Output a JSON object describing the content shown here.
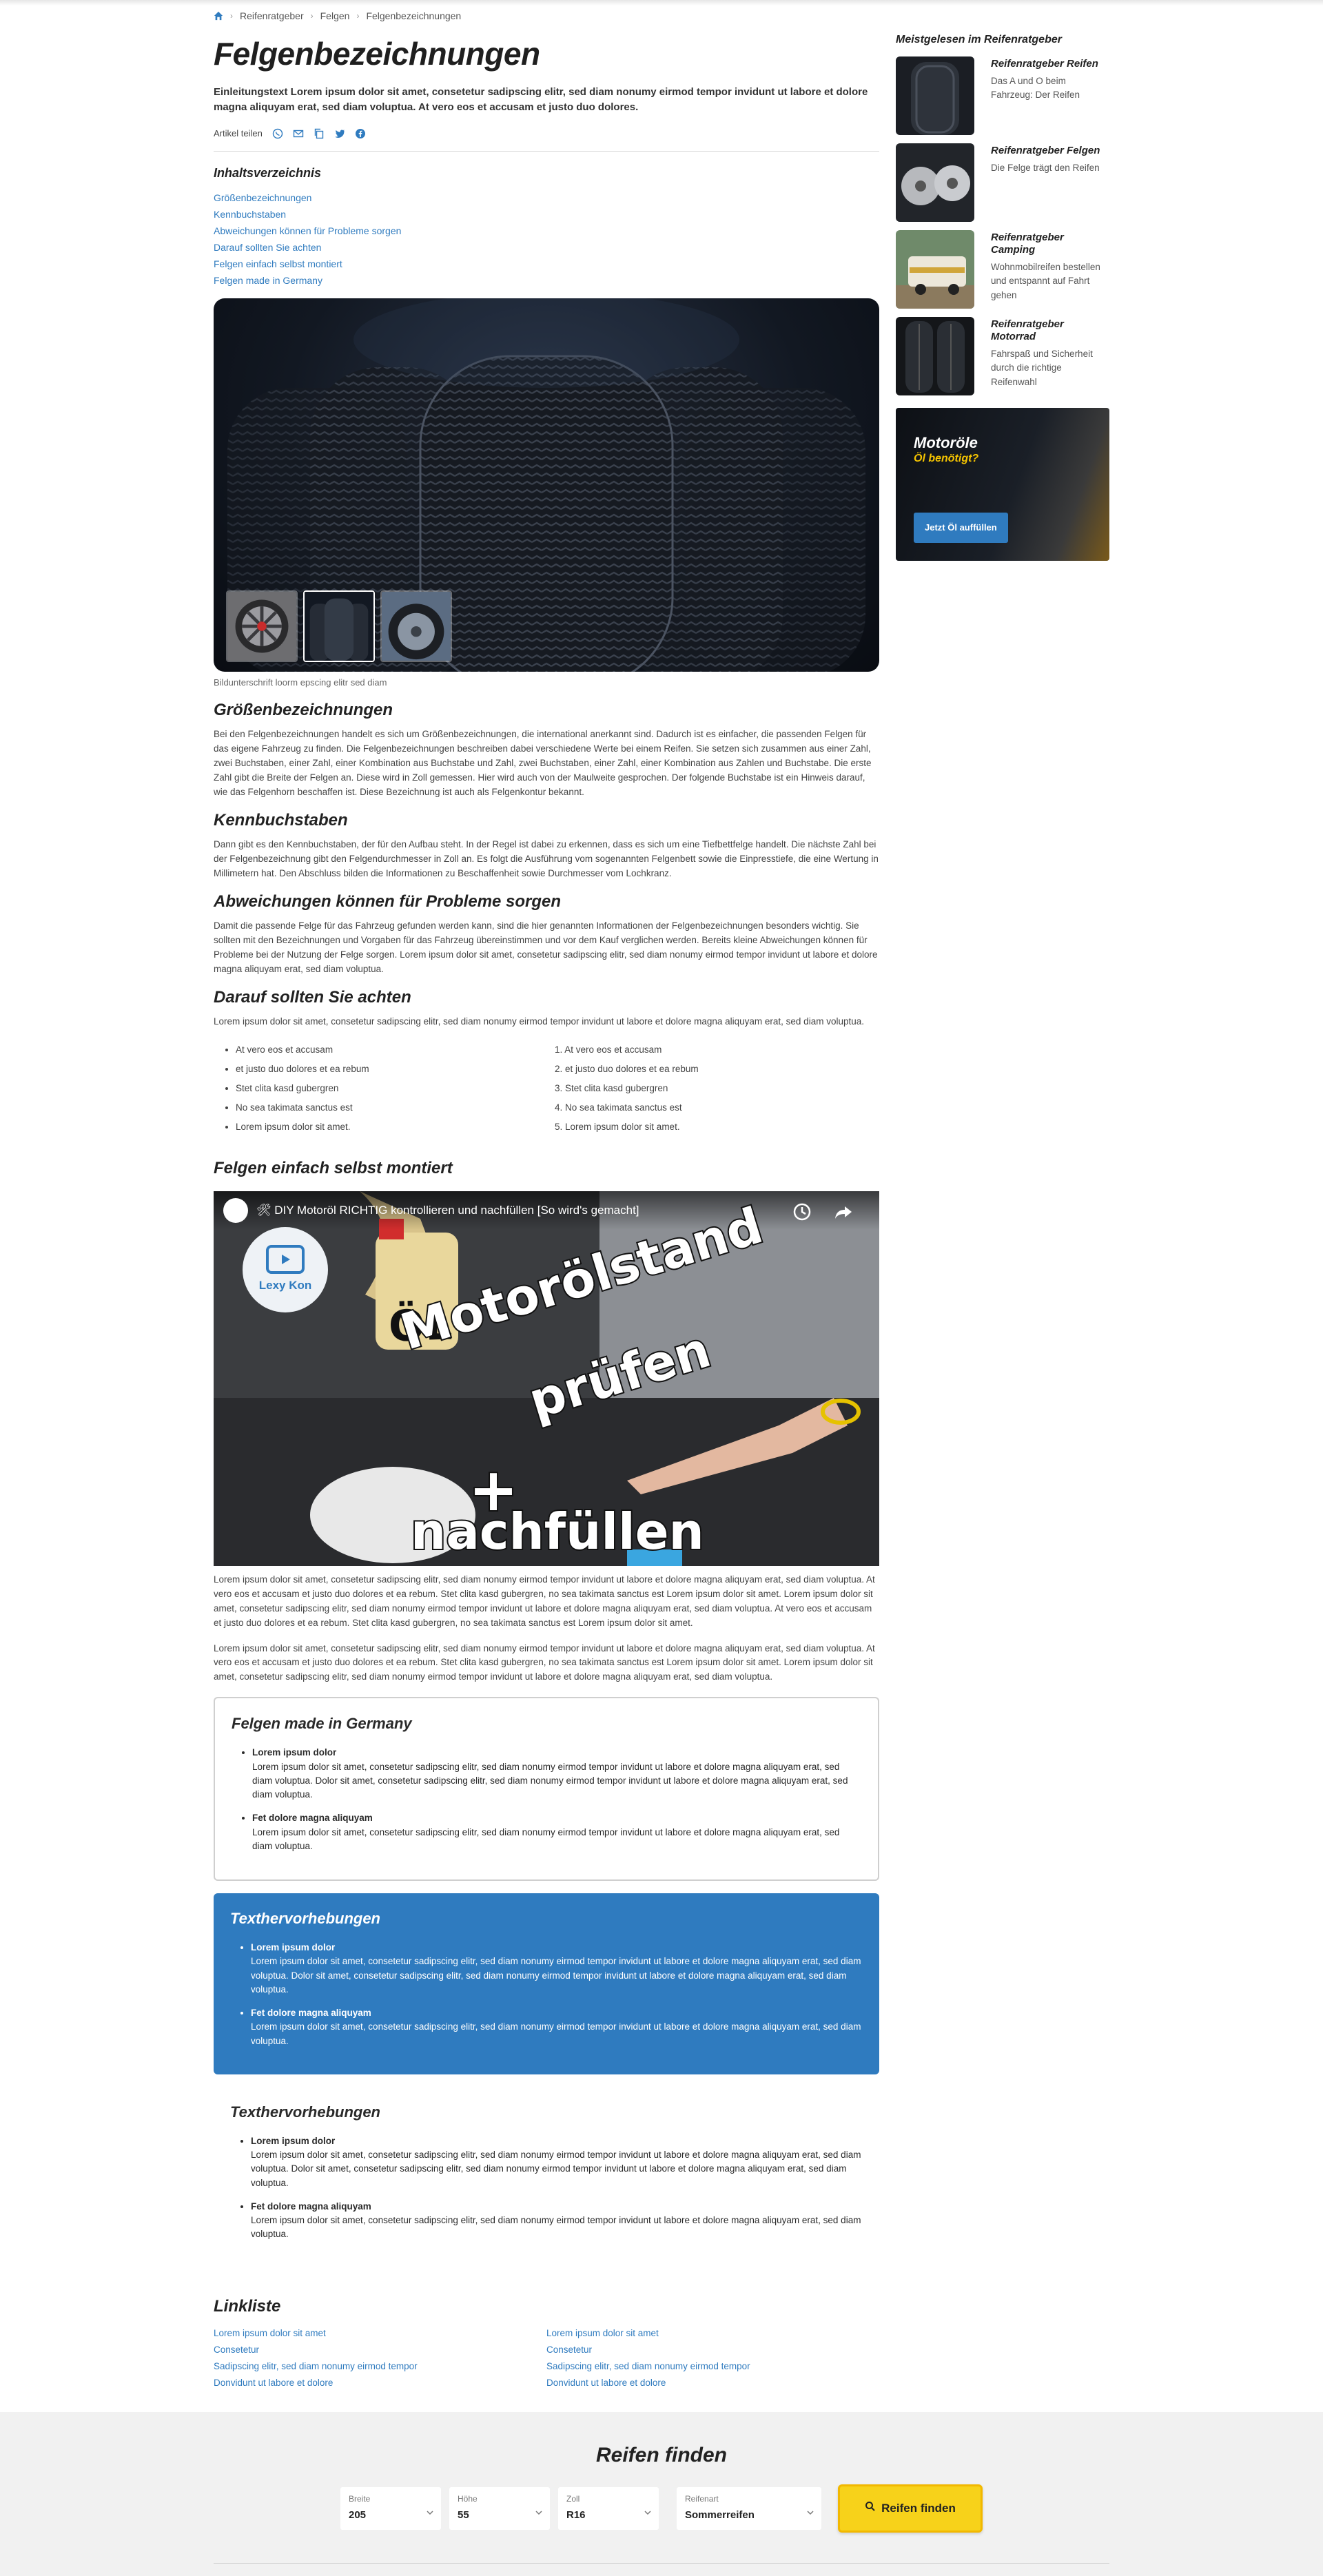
{
  "breadcrumb": [
    "Reifenratgeber",
    "Felgen",
    "Felgenbezeichnungen"
  ],
  "page_title": "Felgenbezeichnungen",
  "intro": "Einleitungstext Lorem ipsum dolor sit amet, consetetur sadipscing elitr, sed diam nonumy eirmod tempor invidunt ut labore et dolore magna aliquyam erat, sed diam voluptua. At vero eos et accusam et justo duo dolores.",
  "share_label": "Artikel teilen",
  "share_icons": [
    "whatsapp-icon",
    "mail-icon",
    "copy-icon",
    "twitter-icon",
    "facebook-icon"
  ],
  "toc": {
    "title": "Inhaltsverzeichnis",
    "items": [
      "Größenbezeichnungen",
      "Kennbuchstaben",
      "Abweichungen können für Probleme sorgen",
      "Darauf sollten Sie achten",
      "Felgen einfach selbst montiert",
      "Felgen made in Germany"
    ]
  },
  "hero_caption": "Bildunterschrift loorm epscing elitr sed diam",
  "sections": [
    {
      "title": "Größenbezeichnungen",
      "text": "Bei den Felgenbezeichnungen handelt es sich um Größenbezeichnungen, die international anerkannt sind. Dadurch ist es einfacher, die passenden Felgen für das eigene Fahrzeug zu finden. Die Felgenbezeichnungen beschreiben dabei verschiedene Werte bei einem Reifen. Sie setzen sich zusammen aus einer Zahl, zwei Buchstaben, einer Zahl, einer Kombination aus Buchstabe und Zahl, zwei Buchstaben, einer Zahl, einer Kombination aus Zahlen und Buchstabe. Die erste Zahl gibt die Breite der Felgen an. Diese wird in Zoll gemessen. Hier wird auch von der Maulweite gesprochen. Der folgende Buchstabe ist ein Hinweis darauf, wie das Felgenhorn beschaffen ist. Diese Bezeichnung ist auch als Felgenkontur bekannt."
    },
    {
      "title": "Kennbuchstaben",
      "text": "Dann gibt es den Kennbuchstaben, der für den Aufbau steht. In der Regel ist dabei zu erkennen, dass es sich um eine Tiefbettfelge handelt. Die nächste Zahl bei der Felgenbezeichnung gibt den Felgendurchmesser in Zoll an. Es folgt die Ausführung vom sogenannten Felgenbett sowie die Einpresstiefe, die eine Wertung in Millimetern hat. Den Abschluss bilden die Informationen zu Beschaffenheit sowie Durchmesser vom Lochkranz."
    },
    {
      "title": "Abweichungen können für Probleme sorgen",
      "text": "Damit die passende Felge für das Fahrzeug gefunden werden kann, sind die hier genannten Informationen der Felgenbezeichnungen besonders wichtig. Sie sollten mit den Bezeichnungen und Vorgaben für das Fahrzeug übereinstimmen und vor dem Kauf verglichen werden. Bereits kleine Abweichungen können für Probleme bei der Nutzung der Felge sorgen. Lorem ipsum dolor sit amet, consetetur sadipscing elitr, sed diam nonumy eirmod tempor invidunt ut labore et dolore magna aliquyam erat, sed diam voluptua."
    },
    {
      "title": "Darauf sollten Sie achten",
      "text": "Lorem ipsum dolor sit amet, consetetur sadipscing elitr, sed diam nonumy eirmod tempor invidunt ut labore et dolore magna aliquyam erat, sed diam voluptua."
    }
  ],
  "bullet_list": [
    "At vero eos et accusam",
    "et justo duo dolores et ea rebum",
    "Stet clita kasd gubergren",
    "No sea takimata sanctus est",
    "Lorem ipsum dolor sit amet."
  ],
  "numbered_list": [
    "1. At vero eos et accusam",
    "2. et justo duo dolores et ea rebum",
    "3. Stet clita kasd gubergren",
    "4. No sea takimata sanctus est",
    "5. Lorem ipsum dolor sit amet."
  ],
  "video_section": {
    "title": "Felgen einfach selbst montiert",
    "video_title": "🛠 DIY Motoröl RICHTIG kontrollieren und nachfüllen [So wird's gemacht]",
    "channel": "Lexy Kon",
    "overlay_1": "ÖL",
    "overlay_2": "Motorölstand",
    "overlay_3": "prüfen",
    "overlay_4": "+",
    "overlay_5": "nachfüllen"
  },
  "after_video": [
    "Lorem ipsum dolor sit amet, consetetur sadipscing elitr, sed diam nonumy eirmod tempor invidunt ut labore et dolore magna aliquyam erat, sed diam voluptua. At vero eos et accusam et justo duo dolores et ea rebum. Stet clita kasd gubergren, no sea takimata sanctus est Lorem ipsum dolor sit amet. Lorem ipsum dolor sit amet, consetetur sadipscing elitr, sed diam nonumy eirmod tempor invidunt ut labore et dolore magna aliquyam erat, sed diam voluptua. At vero eos et accusam et justo duo dolores et ea rebum. Stet clita kasd gubergren, no sea takimata sanctus est Lorem ipsum dolor sit amet.",
    "Lorem ipsum dolor sit amet, consetetur sadipscing elitr, sed diam nonumy eirmod tempor invidunt ut labore et dolore magna aliquyam erat, sed diam voluptua. At vero eos et accusam et justo duo dolores et ea rebum. Stet clita kasd gubergren, no sea takimata sanctus est Lorem ipsum dolor sit amet. Lorem ipsum dolor sit amet, consetetur sadipscing elitr, sed diam nonumy eirmod tempor invidunt ut labore et dolore magna aliquyam erat, sed diam voluptua."
  ],
  "box_outline": {
    "title": "Felgen made in Germany",
    "items": [
      {
        "head": "Lorem ipsum dolor",
        "text": "Lorem ipsum dolor sit amet, consetetur sadipscing elitr, sed diam nonumy eirmod tempor invidunt ut labore et dolore magna aliquyam erat, sed diam voluptua. Dolor sit amet, consetetur sadipscing elitr, sed diam nonumy eirmod tempor invidunt ut labore et dolore magna aliquyam erat, sed diam voluptua."
      },
      {
        "head": "Fet dolore magna aliquyam",
        "text": "Lorem ipsum dolor sit amet, consetetur sadipscing elitr, sed diam nonumy eirmod tempor invidunt ut labore et dolore magna aliquyam erat, sed diam voluptua."
      }
    ]
  },
  "box_blue": {
    "title": "Texthervorhebungen",
    "items": [
      {
        "head": "Lorem ipsum dolor",
        "text": "Lorem ipsum dolor sit amet, consetetur sadipscing elitr, sed diam nonumy eirmod tempor invidunt ut labore et dolore magna aliquyam erat, sed diam voluptua. Dolor sit amet, consetetur sadipscing elitr, sed diam nonumy eirmod tempor invidunt ut labore et dolore magna aliquyam erat, sed diam voluptua."
      },
      {
        "head": "Fet dolore magna aliquyam",
        "text": "Lorem ipsum dolor sit amet, consetetur sadipscing elitr, sed diam nonumy eirmod tempor invidunt ut labore et dolore magna aliquyam erat, sed diam voluptua."
      }
    ]
  },
  "box_plain": {
    "title": "Texthervorhebungen",
    "items": [
      {
        "head": "Lorem ipsum dolor",
        "text": "Lorem ipsum dolor sit amet, consetetur sadipscing elitr, sed diam nonumy eirmod tempor invidunt ut labore et dolore magna aliquyam erat, sed diam voluptua. Dolor sit amet, consetetur sadipscing elitr, sed diam nonumy eirmod tempor invidunt ut labore et dolore magna aliquyam erat, sed diam voluptua."
      },
      {
        "head": "Fet dolore magna aliquyam",
        "text": "Lorem ipsum dolor sit amet, consetetur sadipscing elitr, sed diam nonumy eirmod tempor invidunt ut labore et dolore magna aliquyam erat, sed diam voluptua."
      }
    ]
  },
  "linkliste": {
    "title": "Linkliste",
    "col1": [
      "Lorem ipsum dolor sit amet",
      "Consetetur",
      "Sadipscing elitr, sed diam nonumy eirmod tempor",
      "Donvidunt ut labore et dolore"
    ],
    "col2": [
      "Lorem ipsum dolor sit amet",
      "Consetetur",
      "Sadipscing elitr, sed diam nonumy eirmod tempor",
      "Donvidunt ut labore et dolore"
    ]
  },
  "aside": {
    "title": "Meistgelesen im Reifenratgeber",
    "posts": [
      {
        "title": "Reifenratgeber Reifen",
        "text": "Das A und O beim Fahrzeug: Der Reifen"
      },
      {
        "title": "Reifenratgeber Felgen",
        "text": "Die Felge trägt den Reifen"
      },
      {
        "title": "Reifenratgeber Camping",
        "text": "Wohnmobilreifen bestellen und entspannt auf Fahrt gehen"
      },
      {
        "title": "Reifenratgeber Motorrad",
        "text": "Fahrspaß und Sicherheit durch die richtige Reifenwahl"
      }
    ],
    "promo": {
      "title": "Motoröle",
      "subtitle": "Öl benötigt?",
      "button": "Jetzt Öl auffüllen"
    }
  },
  "finder": {
    "title": "Reifen finden",
    "fields": [
      {
        "label": "Breite",
        "value": "205"
      },
      {
        "label": "Höhe",
        "value": "55"
      },
      {
        "label": "Zoll",
        "value": "R16"
      },
      {
        "label": "Reifenart",
        "value": "Sommerreifen"
      }
    ],
    "button": "Reifen finden"
  },
  "colors": {
    "accent": "#2f7bbf",
    "yellow": "#f7d21a",
    "finder_bg": "#f1f1f1"
  }
}
